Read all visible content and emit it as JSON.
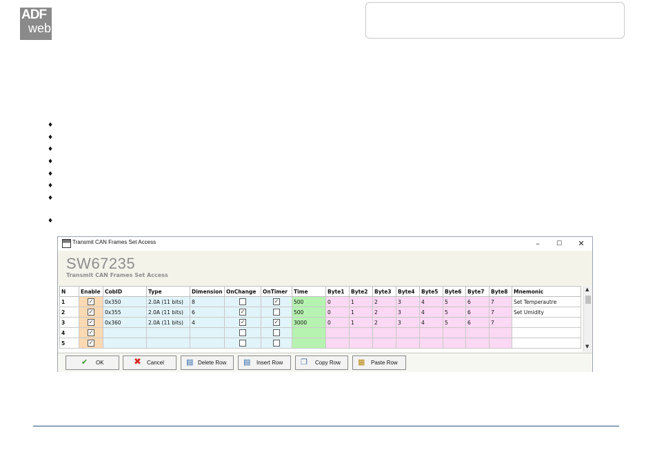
{
  "logo": {
    "line1": "ADF",
    "line2": "web"
  },
  "bullet_glyph": "♦",
  "window": {
    "title": "Transmit CAN Frames Set Access",
    "minimize_glyph": "–",
    "maximize_glyph": "☐",
    "close_glyph": "✕",
    "heading": "SW67235",
    "subheading": "Transmit CAN Frames Set Access"
  },
  "table": {
    "columns": [
      "N",
      "Enable",
      "CobID",
      "Type",
      "Dimension",
      "OnChange",
      "OnTimer",
      "Time",
      "Byte1",
      "Byte2",
      "Byte3",
      "Byte4",
      "Byte5",
      "Byte6",
      "Byte7",
      "Byte8",
      "Mnemonic"
    ],
    "rows": [
      {
        "n": "1",
        "enable": true,
        "cobid": "0x350",
        "type": "2.0A (11 bits)",
        "dimension": "8",
        "onchange": false,
        "ontimer": true,
        "time": "500",
        "bytes": [
          "0",
          "1",
          "2",
          "3",
          "4",
          "5",
          "6",
          "7"
        ],
        "mnemonic": "Set Temperautre"
      },
      {
        "n": "2",
        "enable": true,
        "cobid": "0x355",
        "type": "2.0A (11 bits)",
        "dimension": "6",
        "onchange": true,
        "ontimer": false,
        "time": "500",
        "bytes": [
          "0",
          "1",
          "2",
          "3",
          "4",
          "5",
          "6",
          "7"
        ],
        "mnemonic": "Set Umidity"
      },
      {
        "n": "3",
        "enable": true,
        "cobid": "0x360",
        "type": "2.0A (11 bits)",
        "dimension": "4",
        "onchange": true,
        "ontimer": true,
        "time": "3000",
        "bytes": [
          "0",
          "1",
          "2",
          "3",
          "4",
          "5",
          "6",
          "7"
        ],
        "mnemonic": ""
      },
      {
        "n": "4",
        "enable": true,
        "cobid": "",
        "type": "",
        "dimension": "",
        "onchange": false,
        "ontimer": false,
        "time": "",
        "bytes": [
          "",
          "",
          "",
          "",
          "",
          "",
          "",
          ""
        ],
        "mnemonic": ""
      },
      {
        "n": "5",
        "enable": true,
        "cobid": "",
        "type": "",
        "dimension": "",
        "onchange": false,
        "ontimer": false,
        "time": "",
        "bytes": [
          "",
          "",
          "",
          "",
          "",
          "",
          "",
          ""
        ],
        "mnemonic": ""
      }
    ]
  },
  "buttons": {
    "ok": "OK",
    "cancel": "Cancel",
    "delete_row": "Delete Row",
    "insert_row": "Insert Row",
    "copy_row": "Copy Row",
    "paste_row": "Paste Row"
  },
  "colors": {
    "enable_col": "#fbd9b3",
    "cyan_cols": "#e1f4fa",
    "green_cols": "#b6f3b0",
    "pink_cols": "#fbd8f3",
    "rule_line": "#1f4e79"
  }
}
